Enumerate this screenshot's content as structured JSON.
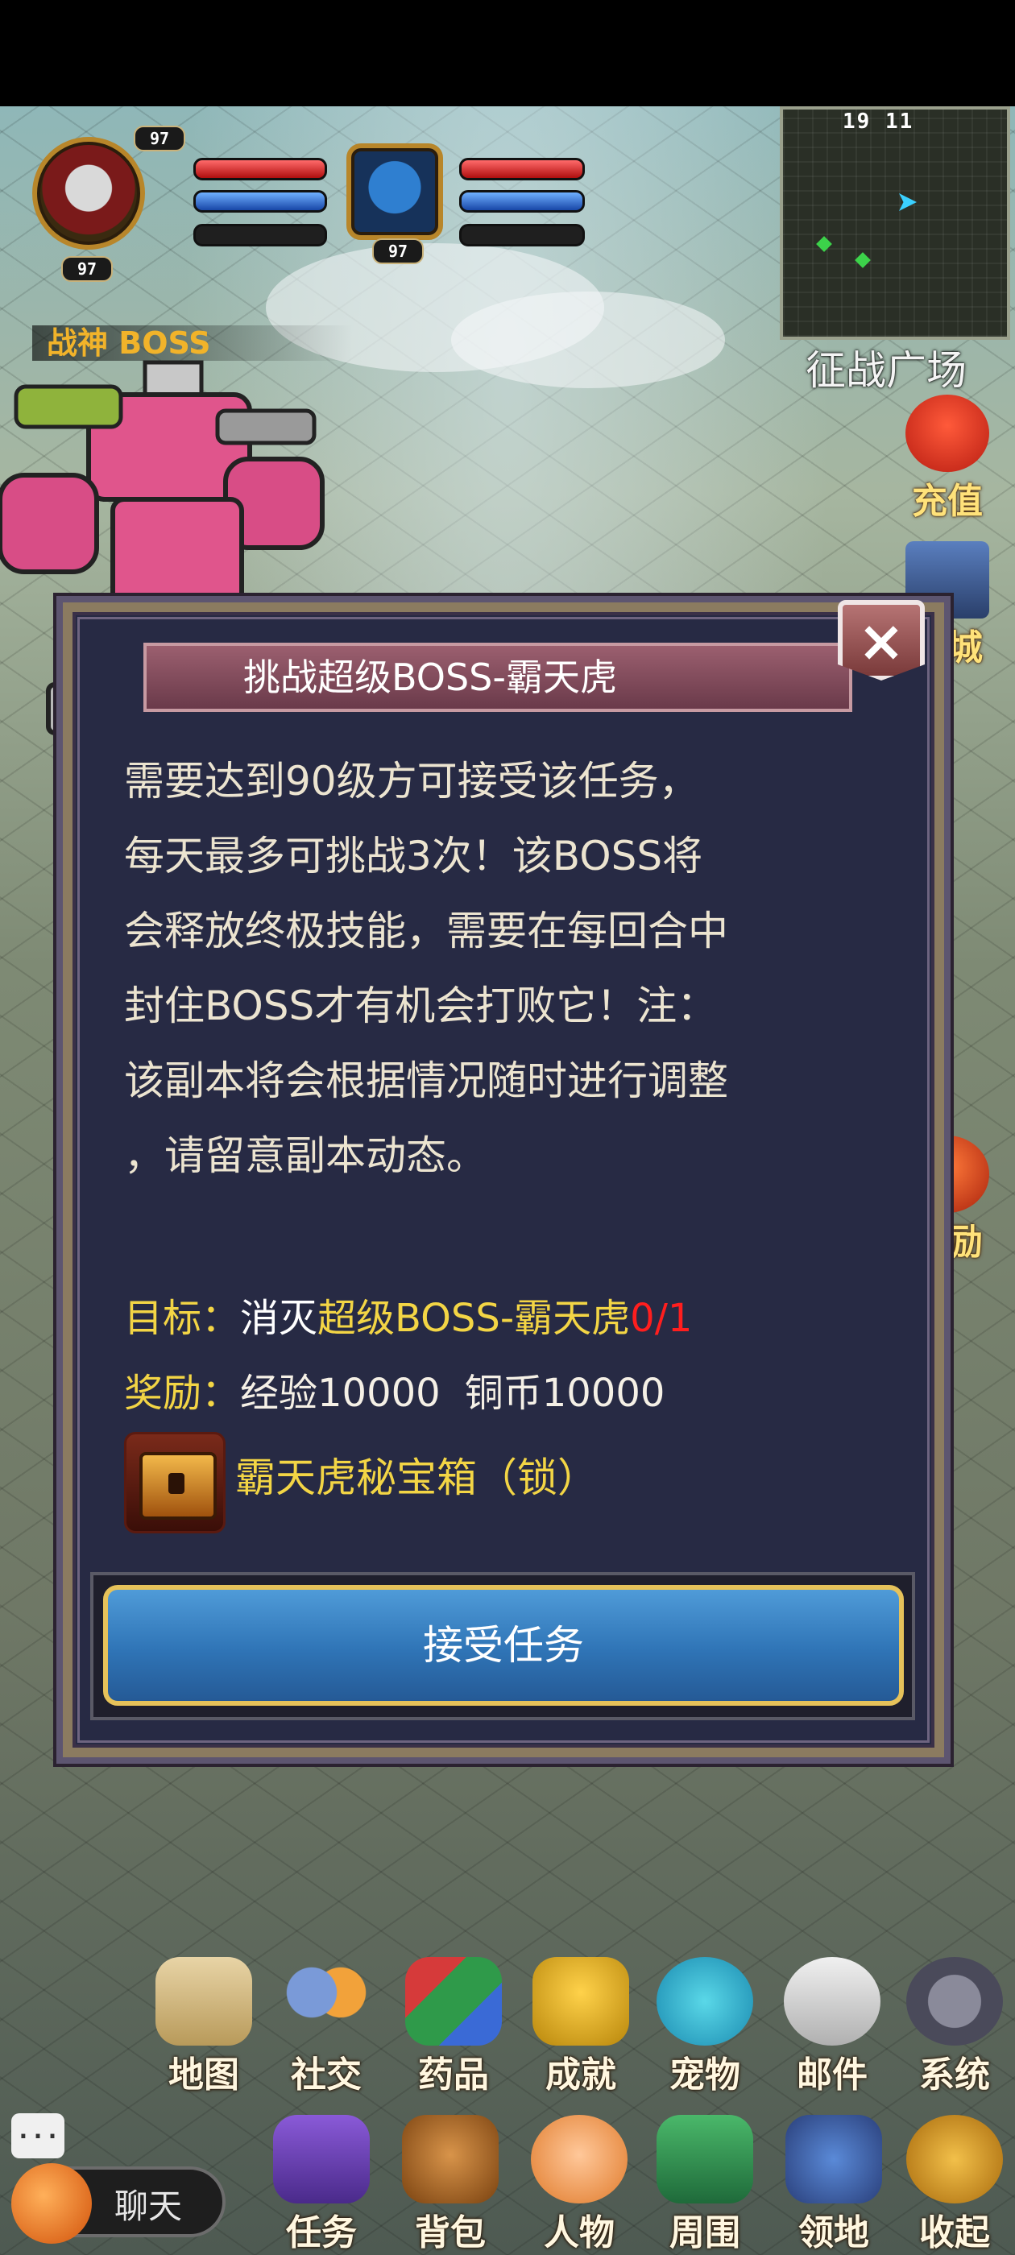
{
  "hud": {
    "player_level_top": "97",
    "player_level_bottom": "97",
    "pet_level": "97"
  },
  "minimap": {
    "coords": "19  11"
  },
  "zone": {
    "name": "征战广场"
  },
  "boss_label": {
    "text": "战神 BOSS"
  },
  "side_buttons": [
    {
      "label": "充值",
      "icon": "gift-bag-icon"
    },
    {
      "label": "商城",
      "icon": "shop-icon"
    },
    {
      "label": "奖励",
      "icon": "gift-icon"
    }
  ],
  "dialog": {
    "title": "挑战超级BOSS-霸天虎",
    "close": "×",
    "description": [
      "需要达到90级方可接受该任务，",
      "每天最多可挑战3次！该BOSS将",
      "会释放终极技能，需要在每回合中",
      "封住BOSS才有机会打败它！注：",
      "该副本将会根据情况随时进行调整",
      "，请留意副本动态。"
    ],
    "goal": {
      "label": "目标：",
      "verb": "消灭",
      "target": "超级BOSS-霸天虎",
      "progress": "0/1"
    },
    "reward": {
      "label": "奖励：",
      "exp": "经验10000",
      "coins": "铜币10000",
      "item": "霸天虎秘宝箱（锁）"
    },
    "accept_button": "接受任务"
  },
  "menu_row1": [
    {
      "label": "地图",
      "icon": "map-icon"
    },
    {
      "label": "社交",
      "icon": "social-icon"
    },
    {
      "label": "药品",
      "icon": "potion-icon"
    },
    {
      "label": "成就",
      "icon": "trophy-icon"
    },
    {
      "label": "宠物",
      "icon": "pet-icon"
    },
    {
      "label": "邮件",
      "icon": "mail-icon"
    },
    {
      "label": "系统",
      "icon": "gear-icon"
    }
  ],
  "menu_row2": [
    {
      "label": "任务",
      "icon": "quest-book-icon"
    },
    {
      "label": "背包",
      "icon": "backpack-icon"
    },
    {
      "label": "人物",
      "icon": "character-icon"
    },
    {
      "label": "周围",
      "icon": "surroundings-icon"
    },
    {
      "label": "领地",
      "icon": "territory-icon"
    },
    {
      "label": "收起",
      "icon": "collapse-icon"
    }
  ],
  "chat": {
    "label": "聊天",
    "bubble": "..."
  },
  "colors": {
    "goal_text": "#f3d545",
    "progress": "#ff1e1e",
    "button": "#2f74b6",
    "dialog_bg": "#272a44"
  }
}
